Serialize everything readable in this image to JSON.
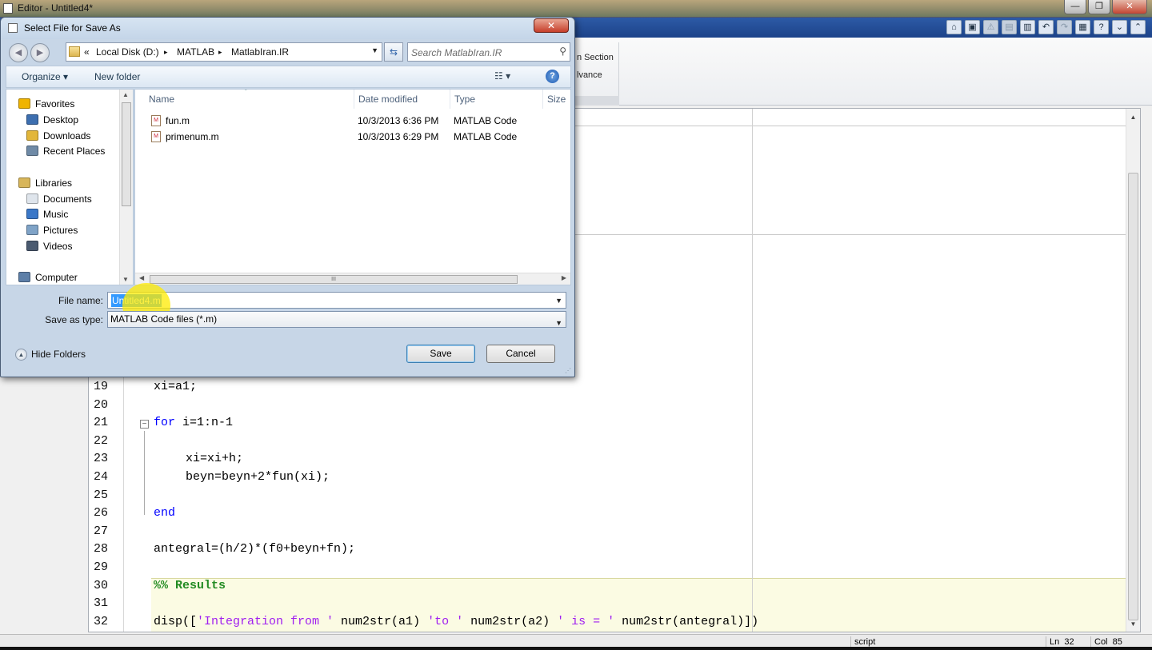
{
  "window": {
    "title": "Editor - Untitled4*",
    "controls": [
      "—",
      "❐",
      "✕"
    ]
  },
  "ribbon": {
    "section_label": "n Section",
    "advance_label": "lvance"
  },
  "quick_access": [
    "⌂",
    "▣",
    "⚠",
    "▤",
    "▥",
    "↶",
    "↷",
    "▦",
    "?",
    "⌄",
    "⌃"
  ],
  "editor": {
    "lines": [
      {
        "num": "19",
        "code": "xi=a1;",
        "type": "plain",
        "indent": 0
      },
      {
        "num": "20",
        "code": "",
        "type": "plain",
        "indent": 0
      },
      {
        "num": "21",
        "code": "for i=1:n-1",
        "type": "for",
        "indent": 0
      },
      {
        "num": "22",
        "code": "",
        "type": "plain",
        "indent": 0
      },
      {
        "num": "23",
        "code": "xi=xi+h;",
        "type": "plain",
        "indent": 1
      },
      {
        "num": "24",
        "code": "beyn=beyn+2*fun(xi);",
        "type": "plain",
        "indent": 1
      },
      {
        "num": "25",
        "code": "",
        "type": "plain",
        "indent": 0
      },
      {
        "num": "26",
        "code": "end",
        "type": "keyword",
        "indent": 0
      },
      {
        "num": "27",
        "code": "",
        "type": "plain",
        "indent": 0
      },
      {
        "num": "28",
        "code": "antegral=(h/2)*(f0+beyn+fn);",
        "type": "plain",
        "indent": 0
      },
      {
        "num": "29",
        "code": "",
        "type": "plain",
        "indent": 0
      },
      {
        "num": "30",
        "code": "%% Results",
        "type": "comment",
        "indent": 0
      },
      {
        "num": "31",
        "code": "",
        "type": "plain",
        "indent": 0
      },
      {
        "num": "32",
        "code": "disp(['Integration from ' num2str(a1) 'to ' num2str(a2) ' is = ' num2str(antegral)])",
        "type": "disp",
        "indent": 0
      }
    ],
    "keyword_for": "for",
    "disp_parts": [
      {
        "t": "disp([",
        "c": "plain"
      },
      {
        "t": "'Integration from '",
        "c": "str"
      },
      {
        "t": " num2str(a1) ",
        "c": "plain"
      },
      {
        "t": "'to '",
        "c": "str"
      },
      {
        "t": " num2str(a2) ",
        "c": "plain"
      },
      {
        "t": "' is = '",
        "c": "str"
      },
      {
        "t": " num2str(antegral)])",
        "c": "plain"
      }
    ]
  },
  "statusbar": {
    "mode": "script",
    "ln_label": "Ln",
    "ln": "32",
    "col_label": "Col",
    "col": "85"
  },
  "dialog": {
    "title": "Select File for Save As",
    "close": "✕",
    "address": {
      "prefix": "«",
      "crumbs": [
        "Local Disk (D:)",
        "MATLAB",
        "MatlabIran.IR"
      ],
      "sep": "▸"
    },
    "search_placeholder": "Search MatlabIran.IR",
    "toolbar": {
      "organize": "Organize ▾",
      "new_folder": "New folder",
      "views": "☷ ▾",
      "help": "?"
    },
    "nav": [
      {
        "label": "Favorites",
        "icon": "star-icon",
        "color": "#f0b400",
        "level": 0
      },
      {
        "label": "Desktop",
        "icon": "desktop-icon",
        "color": "#3d6fb0",
        "level": 1
      },
      {
        "label": "Downloads",
        "icon": "downloads-icon",
        "color": "#e2b63a",
        "level": 1
      },
      {
        "label": "Recent Places",
        "icon": "recent-places-icon",
        "color": "#6f8aa6",
        "level": 1
      },
      {
        "label": "",
        "icon": "",
        "color": "",
        "level": -1
      },
      {
        "label": "Libraries",
        "icon": "libraries-icon",
        "color": "#d8b65a",
        "level": 0
      },
      {
        "label": "Documents",
        "icon": "documents-icon",
        "color": "#dfe5ec",
        "level": 1
      },
      {
        "label": "Music",
        "icon": "music-icon",
        "color": "#3b78c8",
        "level": 1
      },
      {
        "label": "Pictures",
        "icon": "pictures-icon",
        "color": "#7fa3c7",
        "level": 1
      },
      {
        "label": "Videos",
        "icon": "videos-icon",
        "color": "#4a5a70",
        "level": 1
      },
      {
        "label": "",
        "icon": "",
        "color": "",
        "level": -1
      },
      {
        "label": "Computer",
        "icon": "computer-icon",
        "color": "#5d7fa8",
        "level": 0
      }
    ],
    "columns": [
      "Name",
      "Date modified",
      "Type",
      "Size"
    ],
    "files": [
      {
        "name": "fun.m",
        "date": "10/3/2013 6:36 PM",
        "type": "MATLAB Code",
        "size": ""
      },
      {
        "name": "primenum.m",
        "date": "10/3/2013 6:29 PM",
        "type": "MATLAB Code",
        "size": ""
      }
    ],
    "hscroll_grip": "III",
    "file_name_label": "File name:",
    "file_name_value": "Untitled4.m",
    "save_type_label": "Save as type:",
    "save_type_value": "MATLAB Code files (*.m)",
    "hide_folders": "Hide Folders",
    "save_button": "Save",
    "cancel_button": "Cancel"
  }
}
